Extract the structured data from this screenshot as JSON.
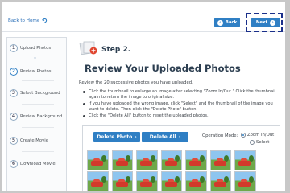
{
  "header": {
    "back_home_label": "Back to Home",
    "back_label": "Back",
    "next_label": "Next"
  },
  "sidebar": {
    "steps": [
      {
        "num": "1",
        "label": "Upload Photos"
      },
      {
        "num": "2",
        "label": "Review Photos",
        "active": true
      },
      {
        "num": "3",
        "label": "Select Background"
      },
      {
        "num": "4",
        "label": "Review Background"
      },
      {
        "num": "5",
        "label": "Create Movie"
      },
      {
        "num": "6",
        "label": "Download Movie"
      }
    ]
  },
  "main": {
    "step_label": "Step 2.",
    "title": "Review Your Uploaded Photos",
    "intro": "Review the 20 successive photos you have uploaded.",
    "bullets": [
      "Click the thumbnail to enlarge an image after selecting \"Zoom In/Out.\" Click the thumbnail again to return the image to original size.",
      "If you have uploaded the wrong image, click \"Select\" and the thumbnail of the image you want to delete. Then click the \"Delete Photo\" button.",
      "Click the \"Delete All\" button to reset the uploaded photos."
    ]
  },
  "panel": {
    "delete_photo_label": "Delete Photo",
    "delete_all_label": "Delete All",
    "operation_mode_label": "Operation Mode:",
    "mode_options": [
      "Zoom In/Out",
      "Select"
    ],
    "selected_mode": "Zoom In/Out"
  },
  "colors": {
    "accent": "#2f7fc4",
    "title": "#2c3e50",
    "highlight_dash": "#1a2f8a"
  }
}
